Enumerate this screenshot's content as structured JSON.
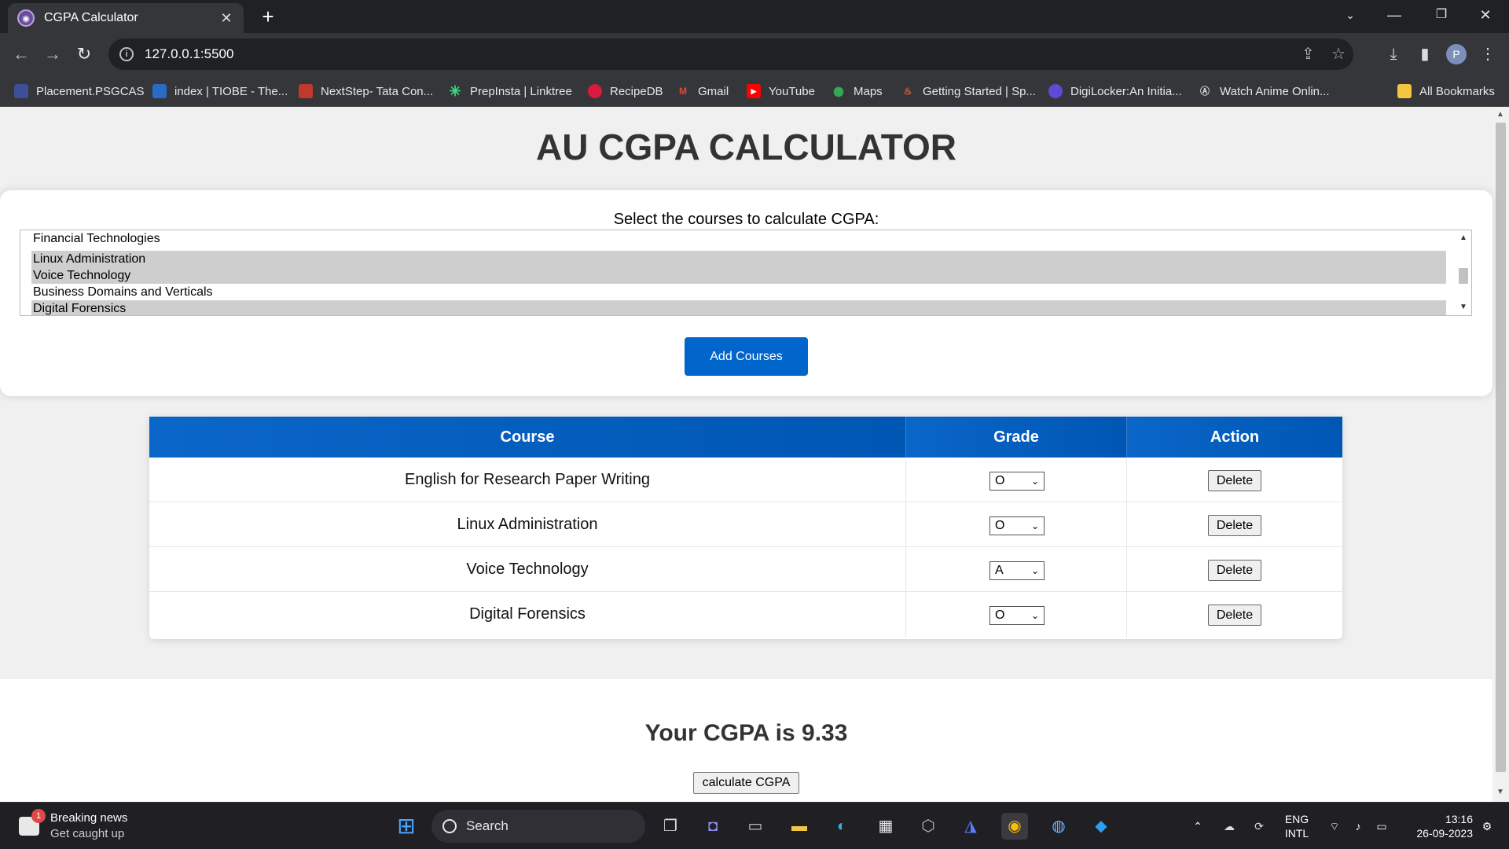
{
  "browser": {
    "tab_title": "CGPA Calculator",
    "url": "127.0.0.1:5500",
    "profile_initial": "P",
    "bookmarks": [
      "Placement.PSGCAS",
      "index | TIOBE - The...",
      "NextStep- Tata Con...",
      "PrepInsta | Linktree",
      "RecipeDB",
      "Gmail",
      "YouTube",
      "Maps",
      "Getting Started | Sp...",
      "DigiLocker:An Initia...",
      "Watch Anime Onlin..."
    ],
    "all_bookmarks": "All Bookmarks"
  },
  "page": {
    "title": "AU CGPA CALCULATOR",
    "select_label": "Select the courses to calculate CGPA:",
    "course_options": [
      {
        "label": "Financial Technologies",
        "selected": false
      },
      {
        "label": "Linux Administration",
        "selected": true
      },
      {
        "label": "Voice Technology",
        "selected": true
      },
      {
        "label": "Business Domains and Verticals",
        "selected": false
      },
      {
        "label": "Digital Forensics",
        "selected": true
      }
    ],
    "add_button": "Add Courses",
    "table": {
      "headers": [
        "Course",
        "Grade",
        "Action"
      ],
      "rows": [
        {
          "course": "English for Research Paper Writing",
          "grade": "O",
          "action": "Delete"
        },
        {
          "course": "Linux Administration",
          "grade": "O",
          "action": "Delete"
        },
        {
          "course": "Voice Technology",
          "grade": "A",
          "action": "Delete"
        },
        {
          "course": "Digital Forensics",
          "grade": "O",
          "action": "Delete"
        }
      ]
    },
    "result": "Your CGPA is 9.33",
    "calculate_button": "calculate CGPA"
  },
  "taskbar": {
    "news_title": "Breaking news",
    "news_subtitle": "Get caught up",
    "news_badge": "1",
    "search_placeholder": "Search",
    "language": "ENG",
    "layout": "INTL",
    "time": "13:16",
    "date": "26-09-2023"
  }
}
